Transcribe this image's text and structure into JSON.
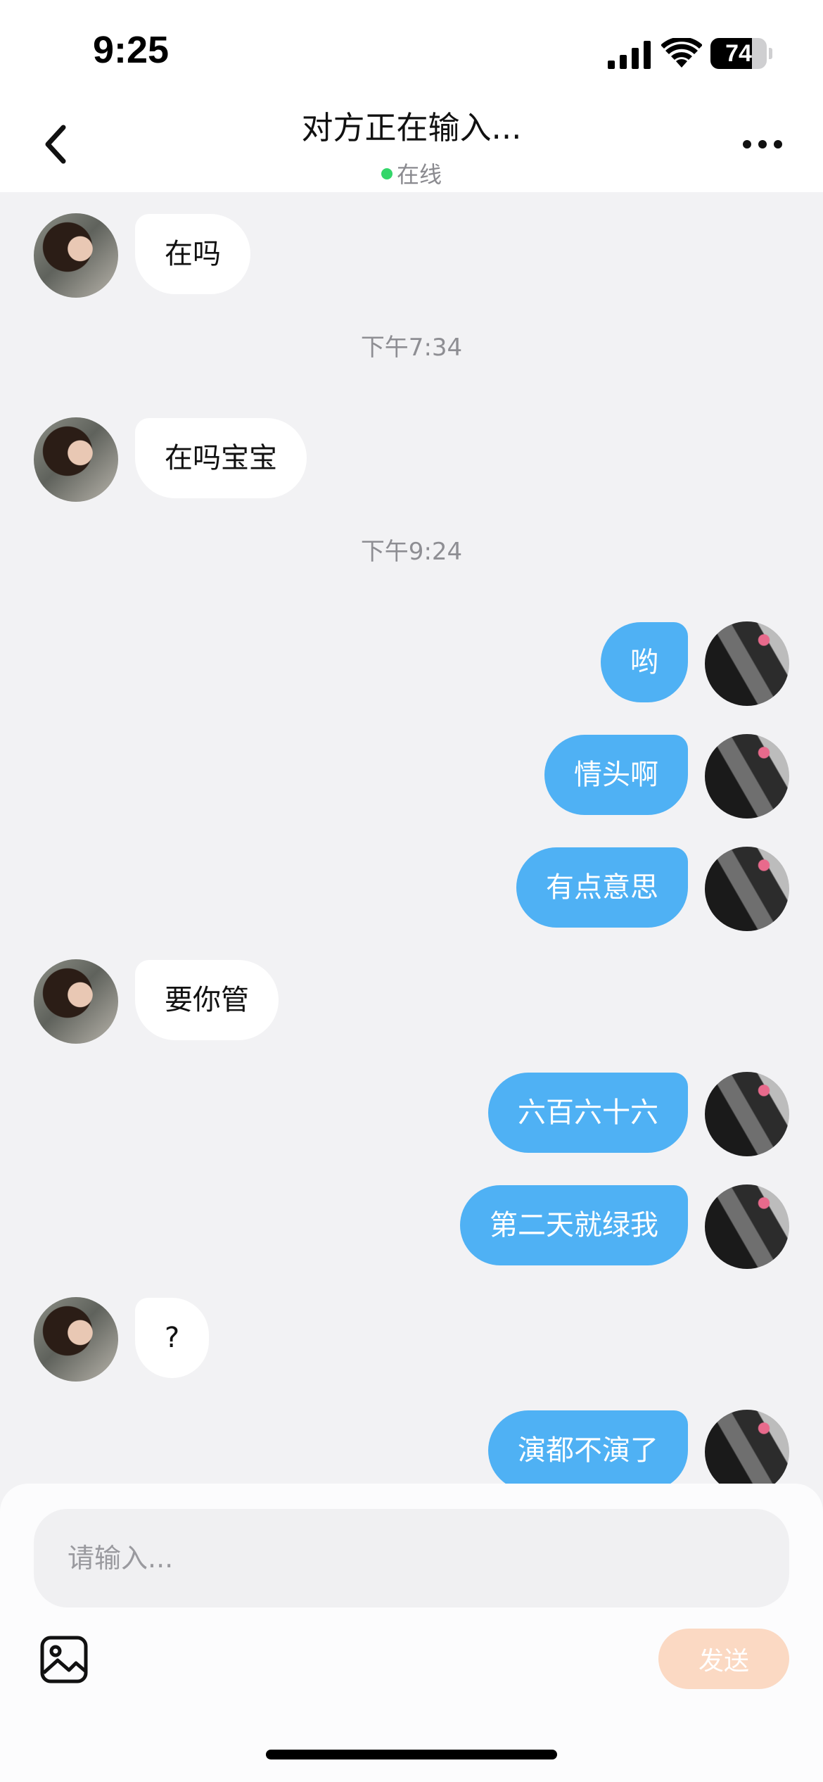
{
  "status_bar": {
    "time": "9:25",
    "battery_level": "74",
    "battery_fraction": 0.74,
    "icons": [
      "signal-icon",
      "wifi-icon",
      "battery-icon"
    ]
  },
  "header": {
    "title": "对方正在输入...",
    "status": "在线",
    "status_color": "#34d66a"
  },
  "messages": [
    {
      "side": "left",
      "text": "在吗"
    },
    {
      "type": "time",
      "text": "下午7:34"
    },
    {
      "side": "left",
      "text": "在吗宝宝"
    },
    {
      "type": "time",
      "text": "下午9:24"
    },
    {
      "side": "right",
      "text": "哟"
    },
    {
      "side": "right",
      "text": "情头啊"
    },
    {
      "side": "right",
      "text": "有点意思"
    },
    {
      "side": "left",
      "text": "要你管"
    },
    {
      "side": "right",
      "text": "六百六十六"
    },
    {
      "side": "right",
      "text": "第二天就绿我"
    },
    {
      "side": "left",
      "text": "?"
    },
    {
      "side": "right",
      "text": "演都不演了"
    }
  ],
  "composer": {
    "placeholder": "请输入...",
    "value": "",
    "send_label": "发送",
    "send_color": "#fbd9c3"
  },
  "colors": {
    "outgoing_bubble": "#4fb1f4",
    "incoming_bubble": "#ffffff",
    "background": "#f2f2f4"
  }
}
